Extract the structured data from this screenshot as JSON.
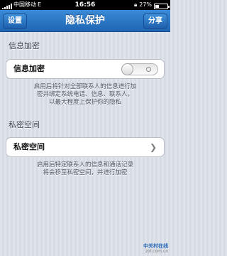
{
  "status_bar": {
    "carrier": "中国移动",
    "network": "E",
    "time": "16:56",
    "battery_percent": "27%",
    "battery_level": 0.27
  },
  "nav": {
    "left_button": "设置",
    "title": "隐私保护",
    "right_button": "分享"
  },
  "encryption": {
    "section_title": "信息加密",
    "cell_label": "信息加密",
    "toggle_on": false,
    "note_lines": [
      "启用后将针对全部联系人的信息进行加",
      "密并绑定系统电话、信息、联系人，",
      "以最大程度上保护你的隐私"
    ]
  },
  "private_space": {
    "section_title": "私密空间",
    "cell_label": "私密空间",
    "note_lines": [
      "启用后特定联系人的信息和通话记录",
      "将会移至私密空间，并进行加密"
    ]
  },
  "watermark": {
    "line1": "中关村在线",
    "line2": "zol.com.cn"
  },
  "colors": {
    "nav_bar": "#2a74c4",
    "background": "#dbe0e8"
  }
}
